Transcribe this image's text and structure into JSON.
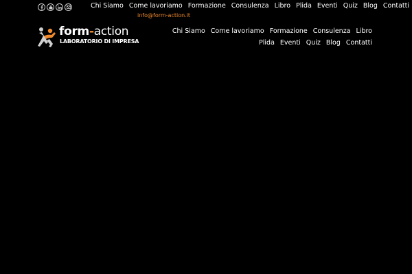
{
  "social": [
    {
      "name": "facebook-icon"
    },
    {
      "name": "youtube-icon"
    },
    {
      "name": "linkedin-icon"
    },
    {
      "name": "email-icon"
    }
  ],
  "top_nav": [
    "Chi Siamo",
    "Come lavoriamo",
    "Formazione",
    "Consulenza",
    "Libro",
    "Plida",
    "Eventi",
    "Quiz",
    "Blog",
    "Contatti"
  ],
  "email": "info@form-action.it",
  "logo": {
    "title_prefix": "form",
    "title_dash": "-",
    "title_suffix": "action",
    "subtitle": "LABORATORIO DI IMPRESA"
  },
  "main_nav": [
    "Chi Siamo",
    "Come lavoriamo",
    "Formazione",
    "Consulenza",
    "Libro",
    "Plida",
    "Eventi",
    "Quiz",
    "Blog",
    "Contatti"
  ],
  "colors": {
    "background": "#000000",
    "accent": "#f28a2e",
    "text": "#ffffff"
  }
}
